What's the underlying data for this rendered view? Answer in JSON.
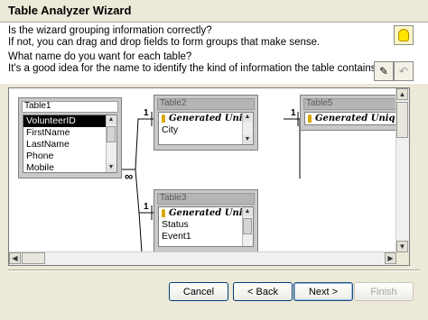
{
  "window": {
    "title": "Table Analyzer Wizard"
  },
  "header": {
    "line1": "Is the wizard grouping information correctly?",
    "line2": "If not, you can drag and drop fields to form groups that make sense.",
    "line3": "What name do you want for each table?",
    "line4": "It's a good idea for the name to identify the kind of information the table contains."
  },
  "toolbar": {
    "rename_icon": "rename-table-icon",
    "undo_icon": "undo-icon",
    "hint_icon": "lightbulb-icon"
  },
  "tables": [
    {
      "name": "Table1",
      "fields": [
        "VolunteerID",
        "FirstName",
        "LastName",
        "Phone",
        "Mobile"
      ],
      "selected": "VolunteerID"
    },
    {
      "name": "Table2",
      "fields": [
        "Generated Uniqu",
        "City"
      ]
    },
    {
      "name": "Table3",
      "fields": [
        "Generated Uniqu",
        "Status",
        "Event1"
      ]
    },
    {
      "name": "Table5",
      "fields": [
        "Generated Uniqu"
      ]
    }
  ],
  "relations": {
    "one_label": "1",
    "many_label": "∞"
  },
  "buttons": {
    "cancel": "Cancel",
    "back": "< Back",
    "next": "Next >",
    "finish": "Finish"
  },
  "colors": {
    "dialog": "#ece9d8",
    "selected_row": "#000000",
    "table_frame": "#c9c9c9"
  }
}
